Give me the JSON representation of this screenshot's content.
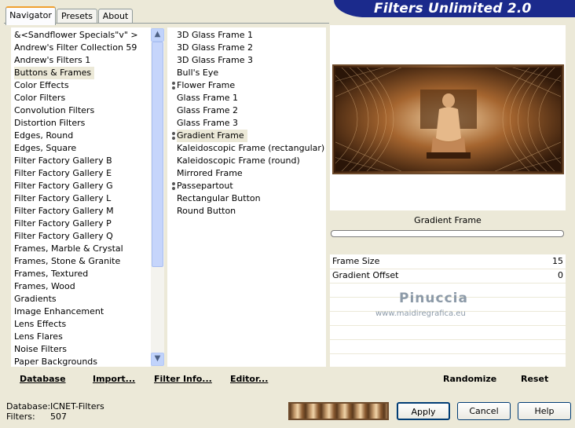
{
  "header": {
    "title": "Filters Unlimited 2.0"
  },
  "tabs": [
    {
      "label": "Navigator"
    },
    {
      "label": "Presets"
    },
    {
      "label": "About"
    }
  ],
  "categories": [
    "&<Sandflower Specials\"v\" >",
    "Andrew's Filter Collection 59",
    "Andrew's Filters 1",
    "Buttons & Frames",
    "Color Effects",
    "Color Filters",
    "Convolution Filters",
    "Distortion Filters",
    "Edges, Round",
    "Edges, Square",
    "Filter Factory Gallery B",
    "Filter Factory Gallery E",
    "Filter Factory Gallery G",
    "Filter Factory Gallery L",
    "Filter Factory Gallery M",
    "Filter Factory Gallery P",
    "Filter Factory Gallery Q",
    "Frames, Marble & Crystal",
    "Frames, Stone & Granite",
    "Frames, Textured",
    "Frames, Wood",
    "Gradients",
    "Image Enhancement",
    "Lens Effects",
    "Lens Flares",
    "Noise Filters",
    "Paper Backgrounds"
  ],
  "selected_category": "Buttons & Frames",
  "filters": [
    {
      "label": "3D Glass Frame 1",
      "has_grip": false
    },
    {
      "label": "3D Glass Frame 2",
      "has_grip": false
    },
    {
      "label": "3D Glass Frame 3",
      "has_grip": false
    },
    {
      "label": "Bull's Eye",
      "has_grip": false
    },
    {
      "label": "Flower Frame",
      "has_grip": true
    },
    {
      "label": "Glass Frame 1",
      "has_grip": false
    },
    {
      "label": "Glass Frame 2",
      "has_grip": false
    },
    {
      "label": "Glass Frame 3",
      "has_grip": false
    },
    {
      "label": "Gradient Frame",
      "has_grip": true
    },
    {
      "label": "Kaleidoscopic Frame (rectangular)",
      "has_grip": false
    },
    {
      "label": "Kaleidoscopic Frame (round)",
      "has_grip": false
    },
    {
      "label": "Mirrored Frame",
      "has_grip": false
    },
    {
      "label": "Passepartout",
      "has_grip": true
    },
    {
      "label": "Rectangular Button",
      "has_grip": false
    },
    {
      "label": "Round Button",
      "has_grip": false
    }
  ],
  "selected_filter": "Gradient Frame",
  "preview": {
    "filter_name": "Gradient Frame"
  },
  "params": [
    {
      "label": "Frame Size",
      "value": "15"
    },
    {
      "label": "Gradient Offset",
      "value": "0"
    }
  ],
  "watermark": {
    "line1": "Pinuccia",
    "line2": "www.maidiregrafica.eu"
  },
  "toolbar": {
    "database": "Database",
    "import": "Import...",
    "filter_info": "Filter Info...",
    "editor": "Editor...",
    "randomize": "Randomize",
    "reset": "Reset"
  },
  "status": {
    "database_label": "Database:",
    "database_value": "ICNET-Filters",
    "filters_label": "Filters:",
    "filters_value": "507"
  },
  "buttons": {
    "apply": "Apply",
    "cancel": "Cancel",
    "help": "Help"
  },
  "colors": {
    "banner": "#1b2a8c",
    "frame_brown": "#6e4b2c"
  }
}
